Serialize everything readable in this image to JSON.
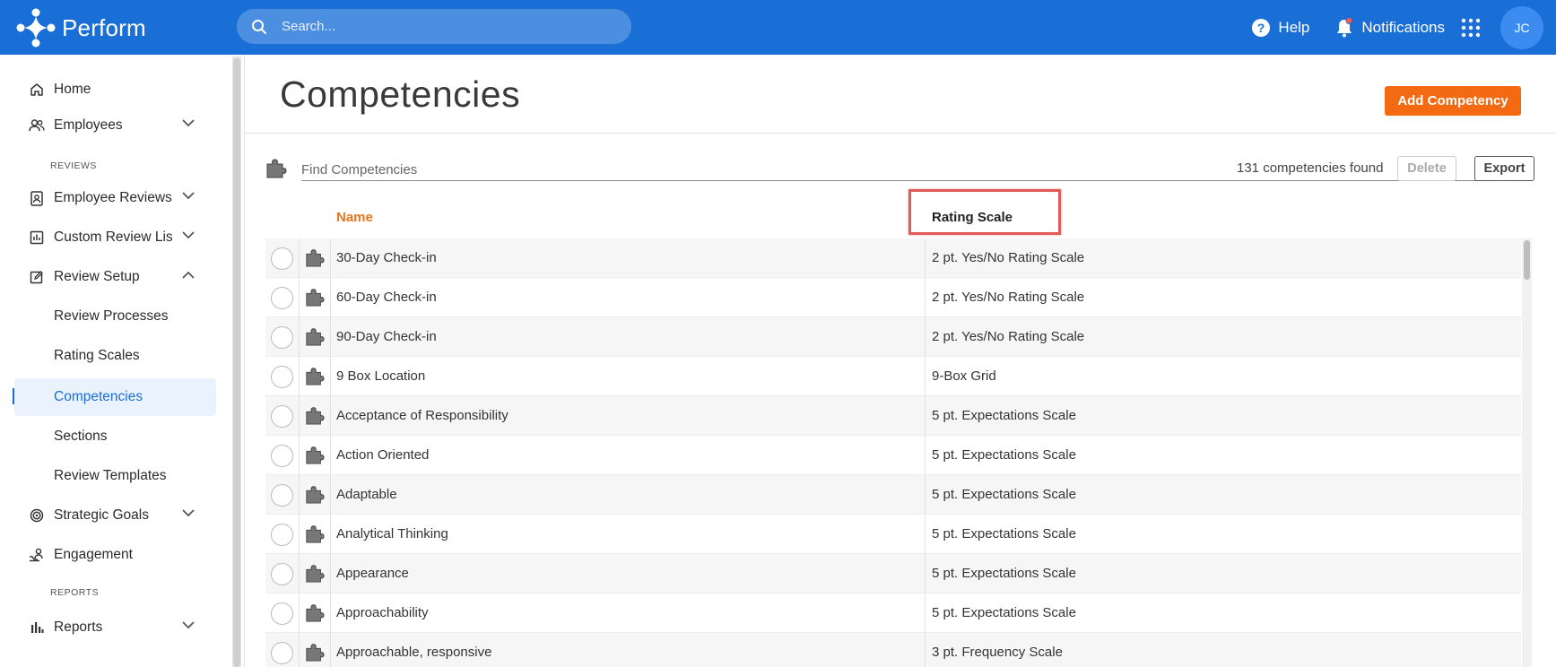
{
  "app": {
    "name": "Perform"
  },
  "topbar": {
    "search_placeholder": "Search...",
    "help_label": "Help",
    "notifications_label": "Notifications",
    "user_initials": "JC"
  },
  "sidebar": {
    "home": "Home",
    "employees": "Employees",
    "section_reviews": "REVIEWS",
    "employee_reviews": "Employee Reviews",
    "custom_review_lists": "Custom Review Lis",
    "review_setup": "Review Setup",
    "review_processes": "Review Processes",
    "rating_scales": "Rating Scales",
    "competencies": "Competencies",
    "sections": "Sections",
    "review_templates": "Review Templates",
    "strategic_goals": "Strategic Goals",
    "engagement": "Engagement",
    "section_reports": "REPORTS",
    "reports": "Reports"
  },
  "page": {
    "title": "Competencies",
    "add_button": "Add Competency",
    "find_placeholder": "Find Competencies",
    "count_text": "131 competencies found",
    "delete_button": "Delete",
    "export_button": "Export"
  },
  "table": {
    "columns": {
      "name": "Name",
      "rating_scale": "Rating Scale"
    },
    "rows": [
      {
        "name": "30-Day Check-in",
        "scale": "2 pt. Yes/No Rating Scale"
      },
      {
        "name": "60-Day Check-in",
        "scale": "2 pt. Yes/No Rating Scale"
      },
      {
        "name": "90-Day Check-in",
        "scale": "2 pt. Yes/No Rating Scale"
      },
      {
        "name": "9 Box Location",
        "scale": "9-Box Grid"
      },
      {
        "name": "Acceptance of Responsibility",
        "scale": "5 pt. Expectations Scale"
      },
      {
        "name": "Action Oriented",
        "scale": "5 pt. Expectations Scale"
      },
      {
        "name": "Adaptable",
        "scale": "5 pt. Expectations Scale"
      },
      {
        "name": "Analytical Thinking",
        "scale": "5 pt. Expectations Scale"
      },
      {
        "name": "Appearance",
        "scale": "5 pt. Expectations Scale"
      },
      {
        "name": "Approachability",
        "scale": "5 pt. Expectations Scale"
      },
      {
        "name": "Approachable, responsive",
        "scale": "3 pt. Frequency Scale"
      }
    ]
  },
  "colors": {
    "brand_blue": "#1a6fd6",
    "accent_orange": "#f36a12",
    "highlight_red": "#e35a5a"
  }
}
